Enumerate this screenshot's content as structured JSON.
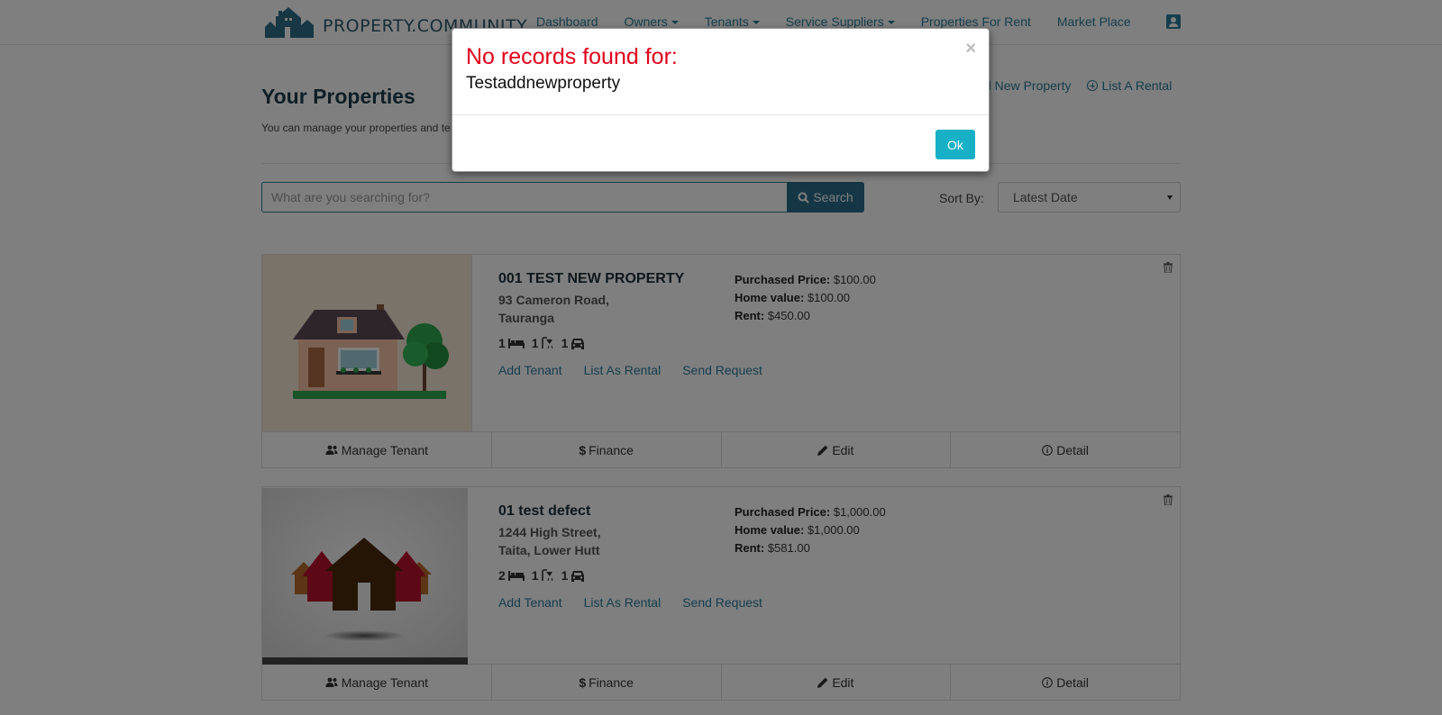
{
  "navbar": {
    "brand": "PROPERTY.COMMUNITY",
    "links": [
      {
        "label": "Dashboard",
        "dropdown": false
      },
      {
        "label": "Owners",
        "dropdown": true
      },
      {
        "label": "Tenants",
        "dropdown": true
      },
      {
        "label": "Service Suppliers",
        "dropdown": true
      },
      {
        "label": "Properties For Rent",
        "dropdown": false
      },
      {
        "label": "Market Place",
        "dropdown": false
      }
    ],
    "user_icon": "user-card-icon"
  },
  "header": {
    "title": "Your Properties",
    "description": "You can manage your properties and te",
    "add_property": "d New Property",
    "list_rental": "List A Rental"
  },
  "search": {
    "placeholder": "What are you searching for?",
    "button_label": "Search",
    "sort_label": "Sort By:",
    "sort_value": "Latest Date"
  },
  "properties": [
    {
      "name": "001 TEST NEW PROPERTY",
      "address_line1": "93 Cameron Road,",
      "address_line2": "Tauranga",
      "bedrooms": "1",
      "bathrooms": "1",
      "parking": "1",
      "purchased_label": "Purchased Price:",
      "purchased_price": "$100.00",
      "home_value_label": "Home value:",
      "home_value": "$100.00",
      "rent_label": "Rent:",
      "rent": "$450.00",
      "links": [
        "Add Tenant",
        "List As Rental",
        "Send Request"
      ],
      "footer": [
        "Manage Tenant",
        "Finance",
        "Edit",
        "Detail"
      ]
    },
    {
      "name": "01 test defect",
      "address_line1": "1244 High Street,",
      "address_line2": "Taita, Lower Hutt",
      "bedrooms": "2",
      "bathrooms": "1",
      "parking": "1",
      "purchased_label": "Purchased Price:",
      "purchased_price": "$1,000.00",
      "home_value_label": "Home value:",
      "home_value": "$1,000.00",
      "rent_label": "Rent:",
      "rent": "$581.00",
      "links": [
        "Add Tenant",
        "List As Rental",
        "Send Request"
      ],
      "footer": [
        "Manage Tenant",
        "Finance",
        "Edit",
        "Detail"
      ]
    }
  ],
  "modal": {
    "title": "No records found for:",
    "query": "Testaddnewproperty",
    "close": "×",
    "ok_label": "Ok"
  },
  "colors": {
    "link": "#2a7d9a",
    "modal_title": "#e0001b",
    "ok_button": "#17b0c7",
    "search_button": "#2a6f8a"
  }
}
